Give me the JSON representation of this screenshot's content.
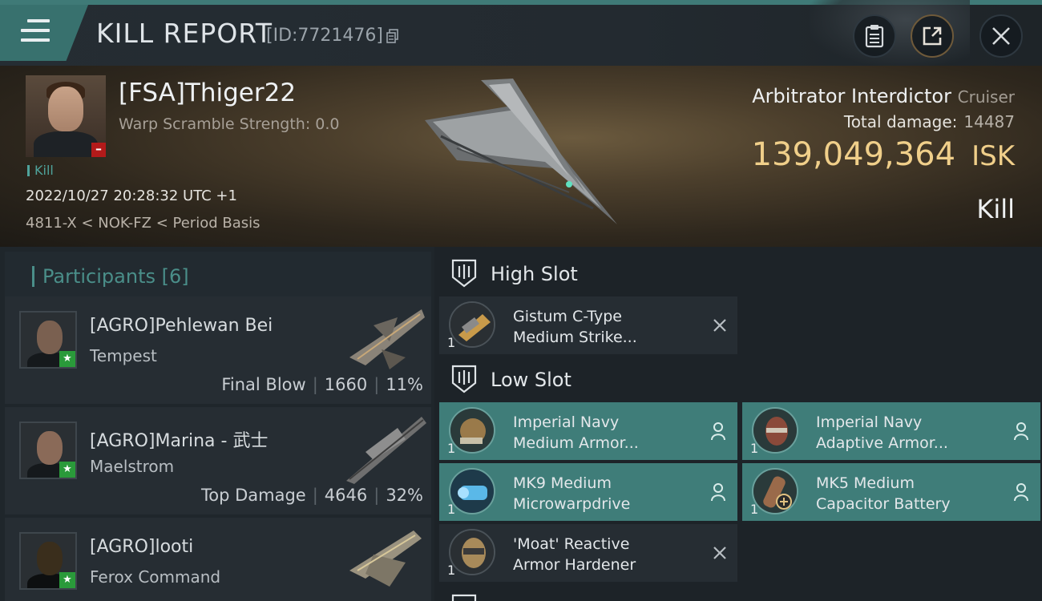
{
  "header": {
    "title": "KILL REPORT",
    "report_id": "[ID:7721476]",
    "icons": [
      "menu-icon",
      "copy-icon",
      "clipboard-icon",
      "share-icon",
      "close-icon"
    ]
  },
  "victim": {
    "name": "[FSA]Thiger22",
    "warp_scramble": "Warp Scramble Strength: 0.0",
    "kill_tag": "Kill",
    "datetime": "2022/10/27 20:28:32 UTC +1",
    "location": "4811-X < NOK-FZ < Period Basis",
    "ship_name": "Arbitrator Interdictor",
    "ship_class": "Cruiser",
    "total_damage_label": "Total damage:",
    "total_damage": "14487",
    "isk_value": "139,049,364",
    "isk_unit": "ISK",
    "result": "Kill"
  },
  "participants": {
    "label": "Participants [6]",
    "rows": [
      {
        "name": "[AGRO]Pehlewan Bei",
        "ship": "Tempest",
        "role": "Final Blow",
        "damage": "1660",
        "percent": "11%"
      },
      {
        "name": "[AGRO]Marina - 武士",
        "ship": "Maelstrom",
        "role": "Top Damage",
        "damage": "4646",
        "percent": "32%"
      },
      {
        "name": "[AGRO]looti",
        "ship": "Ferox Command",
        "role": "",
        "damage": "",
        "percent": ""
      }
    ]
  },
  "fitting": {
    "high_slot_label": "High Slot",
    "low_slot_label": "Low Slot",
    "high": [
      {
        "qty": "1",
        "line1": "Gistum C-Type",
        "line2": "Medium Strike...",
        "status": "destroyed"
      }
    ],
    "low": [
      {
        "qty": "1",
        "line1": "Imperial Navy",
        "line2": "Medium Armor...",
        "status": "dropped"
      },
      {
        "qty": "1",
        "line1": "Imperial Navy",
        "line2": "Adaptive Armor...",
        "status": "dropped"
      },
      {
        "qty": "1",
        "line1": "MK9 Medium",
        "line2": "Microwarpdrive",
        "status": "dropped"
      },
      {
        "qty": "1",
        "line1": "MK5 Medium",
        "line2": "Capacitor Battery",
        "status": "dropped"
      },
      {
        "qty": "1",
        "line1": "'Moat' Reactive",
        "line2": "Armor Hardener",
        "status": "destroyed"
      }
    ]
  },
  "colors": {
    "accent_teal": "#3f7d79",
    "isk_gold": "#f0cf8a",
    "badge_red": "#b31a1a",
    "badge_green": "#2a9a3a"
  }
}
